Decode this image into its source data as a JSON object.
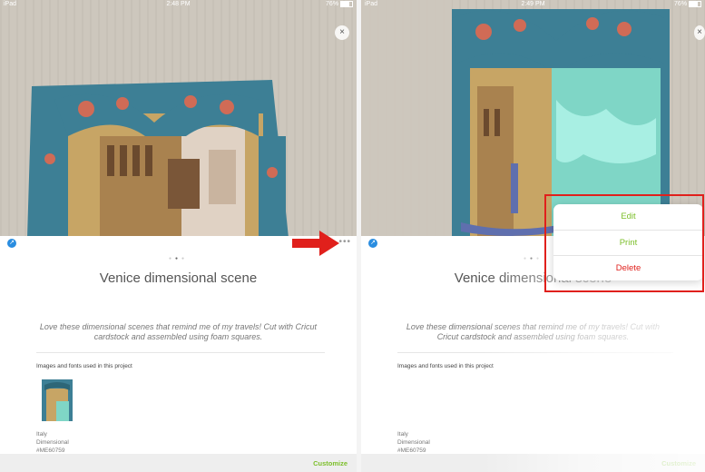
{
  "status": {
    "left": {
      "device": "iPad",
      "time": "2:48 PM",
      "battery": "76%"
    },
    "right": {
      "device": "iPad",
      "time": "2:49 PM",
      "battery": "76%"
    }
  },
  "project": {
    "title": "Venice dimensional scene",
    "description": "Love these dimensional scenes that remind me of my travels! Cut with Cricut cardstock and assembled using foam squares.",
    "section_label": "Images and fonts used in this project",
    "image": {
      "name": "Italy",
      "category": "Dimensional",
      "id": "#ME60759"
    }
  },
  "toolbar": {
    "close": "×",
    "more": "•••",
    "share": "↗"
  },
  "footer": {
    "customize": "Customize"
  },
  "menu": {
    "edit": "Edit",
    "print": "Print",
    "delete": "Delete"
  },
  "colors": {
    "accent_green": "#7cbf2a",
    "delete_red": "#e0201c",
    "share_blue": "#2a8de0",
    "highlight_red": "#e0201c"
  }
}
